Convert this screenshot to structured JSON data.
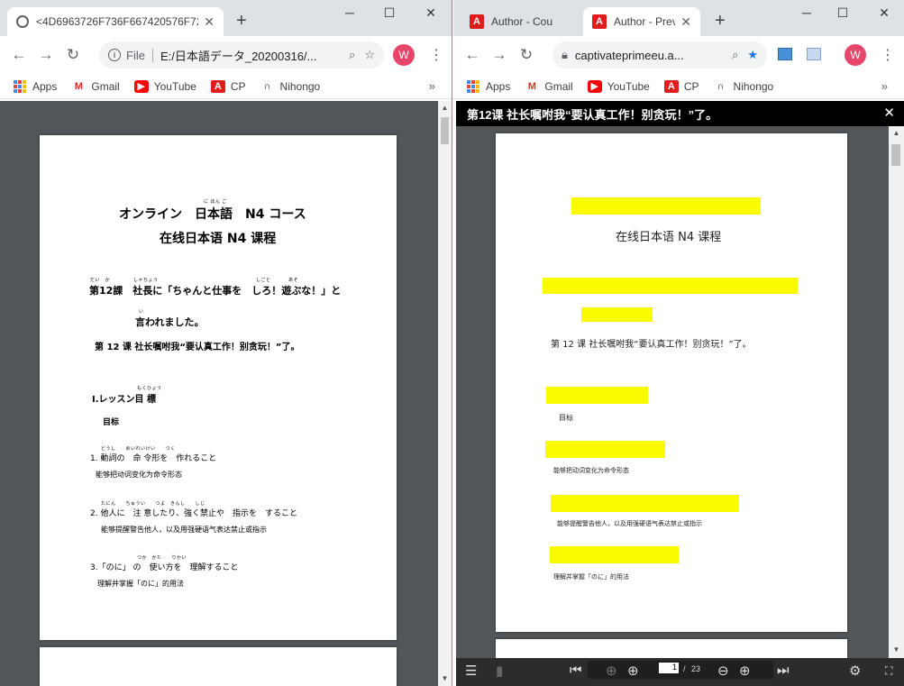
{
  "left_window": {
    "tab_title": "<4D6963726F736F667420576F72",
    "address": "E:/日本語データ_20200316/...",
    "file_label": "File",
    "bookmarks": [
      {
        "label": "Apps",
        "icon": "apps-grid-icon"
      },
      {
        "label": "Gmail",
        "icon": "gmail-icon"
      },
      {
        "label": "YouTube",
        "icon": "youtube-icon"
      },
      {
        "label": "CP",
        "icon": "adobe-icon"
      },
      {
        "label": "Nihongo",
        "icon": "nihongo-icon"
      }
    ],
    "avatar": "W",
    "document": {
      "title_jp": "オンライン　日本語　N4 コース",
      "title_ruby": "に ほん ご",
      "title_cn": "在线日本语 N4 课程",
      "lesson_jp": "第12課　社長に「ちゃんと仕事を　しろ！遊ぶな！」と",
      "lesson_ruby": [
        "だい　か",
        "しゃちょう",
        "しごと",
        "あそ"
      ],
      "lesson_jp2": "言われました。",
      "lesson_ruby2": "い",
      "lesson_cn": "第 12 课 社长嘱咐我“要认真工作！别贪玩！”了。",
      "section": "Ⅰ.レッスン目 標",
      "section_ruby": "もくひょう",
      "goal_cn": "目标",
      "items": [
        {
          "jp": "1. 動詞の　命 令形を　作れること",
          "ruby": "どうし　　めいれいけい　　つく",
          "cn": "能够把动词变化为命令形态"
        },
        {
          "jp": "2. 他人に　注 意したり、強く禁止や　指示を　すること",
          "ruby": "たにん　　ちゅうい　　つよ　きんし　　しじ",
          "cn": "能够提醒警告他人，以及用强硬语气表达禁止或指示"
        },
        {
          "jp": "3.「のに」 の　使い方を　理解すること",
          "ruby": "つか　かた　　りかい",
          "cn": "理解并掌握「のに」的用法"
        }
      ]
    }
  },
  "right_window": {
    "tabs": [
      {
        "title": "Author - Cou",
        "active": false
      },
      {
        "title": "Author - Prev",
        "active": true
      }
    ],
    "address": "captivateprimeeu.a...",
    "bookmarks": [
      {
        "label": "Apps",
        "icon": "apps-grid-icon"
      },
      {
        "label": "Gmail",
        "icon": "gmail-icon"
      },
      {
        "label": "YouTube",
        "icon": "youtube-icon"
      },
      {
        "label": "CP",
        "icon": "adobe-icon"
      },
      {
        "label": "Nihongo",
        "icon": "nihongo-icon"
      }
    ],
    "avatar": "W",
    "dialog_title": "第12课 社长嘱咐我“要认真工作！别贪玩！”了。",
    "document": {
      "title_cn": "在线日本语 N4 课程",
      "lesson_cn": "第 12 课 社长嘱咐我“要认真工作！别贪玩！”了。",
      "goal_cn": "目标",
      "items_cn": [
        "能够把动词变化为命令形态",
        "能够提醒警告他人，以及用强硬语气表达禁止或指示",
        "理解并掌握「のに」的用法"
      ],
      "highlight_color": "#fbfb00"
    },
    "pdf_toolbar": {
      "current_page": "1",
      "separator": "/",
      "total_pages": "23"
    }
  }
}
